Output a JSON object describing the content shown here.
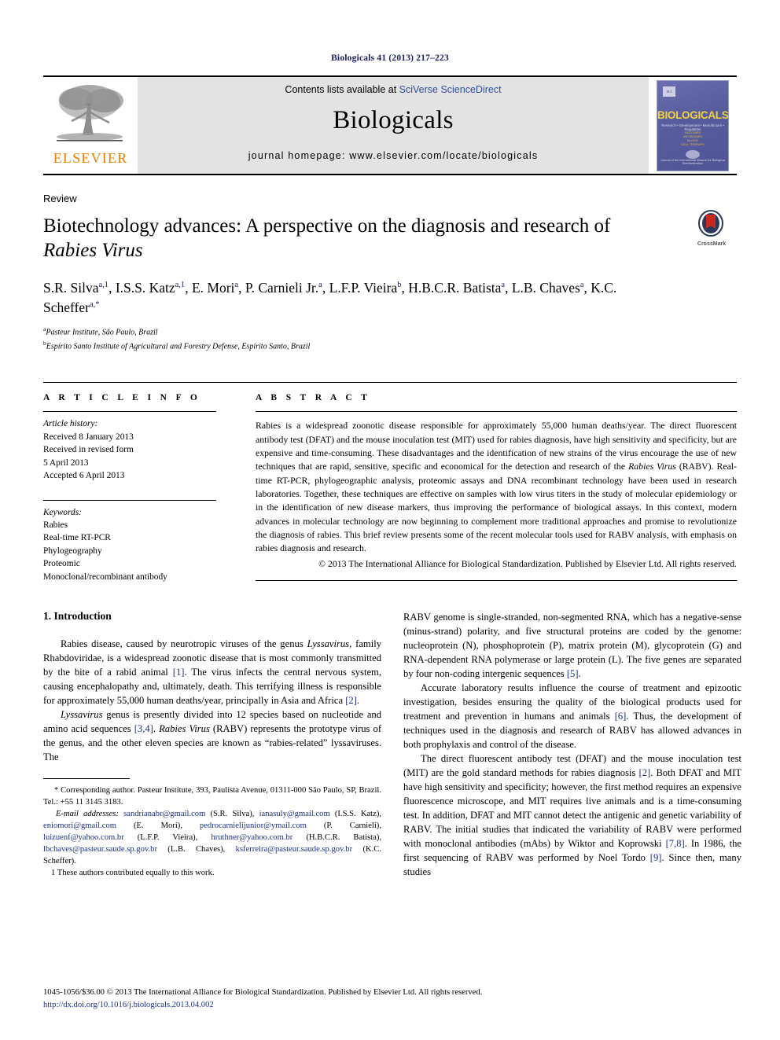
{
  "running_head": "Biologicals 41 (2013) 217–223",
  "masthead": {
    "publisher_name": "ELSEVIER",
    "publisher_logo_icon": "elsevier-tree-icon",
    "contents_prefix": "Contents lists available at ",
    "contents_link": "SciVerse ScienceDirect",
    "journal_name": "Biologicals",
    "homepage": "journal homepage: www.elsevier.com/locate/biologicals",
    "cover": {
      "els_mark": "ELS",
      "title": "BIOLOGICALS",
      "subtitle": "Research • Development • Manufacture • Regulation",
      "lines": "VACCINES\nANTIBODIES\nBLOOD\nCELL THERAPY",
      "footer": "Journal of the International Alliance for Biological Standardization"
    }
  },
  "article": {
    "doctype": "Review",
    "title_part1": "Biotechnology advances: A perspective on the diagnosis and research of ",
    "title_italic": "Rabies Virus",
    "crossmark_label": "CrossMark",
    "authors": "S.R. Silva a,1, I.S.S. Katz a,1, E. Mori a, P. Carnieli Jr. a, L.F.P. Vieira b, H.B.C.R. Batista a, L.B. Chaves a, K.C. Scheffer a,*",
    "affiliation_a": "Pasteur Institute, São Paulo, Brazil",
    "affiliation_b": "Espírito Santo Institute of Agricultural and Forestry Defense, Espírito Santo, Brazil"
  },
  "info": {
    "heading": "A R T I C L E  I N F O",
    "history_label": "Article history:",
    "history": [
      "Received 8 January 2013",
      "Received in revised form",
      "5 April 2013",
      "Accepted 6 April 2013"
    ],
    "keywords_label": "Keywords:",
    "keywords": [
      "Rabies",
      "Real-time RT-PCR",
      "Phylogeography",
      "Proteomic",
      "Monoclonal/recombinant antibody"
    ]
  },
  "abstract": {
    "heading": "A B S T R A C T",
    "text_1": "Rabies is a widespread zoonotic disease responsible for approximately 55,000 human deaths/year. The direct fluorescent antibody test (DFAT) and the mouse inoculation test (MIT) used for rabies diagnosis, have high sensitivity and specificity, but are expensive and time-consuming. These disadvantages and the identification of new strains of the virus encourage the use of new techniques that are rapid, sensitive, specific and economical for the detection and research of the ",
    "italic_1": "Rabies Virus",
    "text_2": " (RABV). Real-time RT-PCR, phylogeographic analysis, proteomic assays and DNA recombinant technology have been used in research laboratories. Together, these techniques are effective on samples with low virus titers in the study of molecular epidemiology or in the identification of new disease markers, thus improving the performance of biological assays. In this context, modern advances in molecular technology are now beginning to complement more traditional approaches and promise to revolutionize the diagnosis of rabies. This brief review presents some of the recent molecular tools used for RABV analysis, with emphasis on rabies diagnosis and research.",
    "copyright": "© 2013 The International Alliance for Biological Standardization. Published by Elsevier Ltd. All rights reserved."
  },
  "body": {
    "section_number_title": "1.  Introduction",
    "left_paragraphs": [
      {
        "segments": [
          {
            "t": "Rabies disease, caused by neurotropic viruses of the genus "
          },
          {
            "t": "Lyssavirus",
            "s": "ital"
          },
          {
            "t": ", family Rhabdoviridae, is a widespread zoonotic disease that is most commonly transmitted by the bite of a rabid animal "
          },
          {
            "t": "[1]",
            "s": "ref"
          },
          {
            "t": ". The virus infects the central nervous system, causing encephalopathy and, ultimately, death. This terrifying illness is responsible for approximately 55,000 human deaths/year, principally in Asia and Africa "
          },
          {
            "t": "[2]",
            "s": "ref"
          },
          {
            "t": "."
          }
        ]
      },
      {
        "segments": [
          {
            "t": "Lyssavirus",
            "s": "ital"
          },
          {
            "t": " genus is presently divided into 12 species based on nucleotide and amino acid sequences "
          },
          {
            "t": "[3,4]",
            "s": "ref"
          },
          {
            "t": ". "
          },
          {
            "t": "Rabies Virus",
            "s": "ital"
          },
          {
            "t": " (RABV) represents the prototype virus of the genus, and the other eleven species are known as “rabies-related” lyssaviruses. The"
          }
        ]
      }
    ],
    "right_paragraphs": [
      {
        "no_indent": true,
        "segments": [
          {
            "t": "RABV genome is single-stranded, non-segmented RNA, which has a negative-sense (minus-strand) polarity, and five structural proteins are coded by the genome: nucleoprotein (N), phosphoprotein (P), matrix protein (M), glycoprotein (G) and RNA-dependent RNA polymerase or large protein (L). The five genes are separated by four non-coding intergenic sequences "
          },
          {
            "t": "[5]",
            "s": "ref"
          },
          {
            "t": "."
          }
        ]
      },
      {
        "segments": [
          {
            "t": "Accurate laboratory results influence the course of treatment and epizootic investigation, besides ensuring the quality of the biological products used for treatment and prevention in humans and animals "
          },
          {
            "t": "[6]",
            "s": "ref"
          },
          {
            "t": ". Thus, the development of techniques used in the diagnosis and research of RABV has allowed advances in both prophylaxis and control of the disease."
          }
        ]
      },
      {
        "segments": [
          {
            "t": "The direct fluorescent antibody test (DFAT) and the mouse inoculation test (MIT) are the gold standard methods for rabies diagnosis "
          },
          {
            "t": "[2]",
            "s": "ref"
          },
          {
            "t": ". Both DFAT and MIT have high sensitivity and specificity; however, the first method requires an expensive fluorescence microscope, and MIT requires live animals and is a time-consuming test. In addition, DFAT and MIT cannot detect the antigenic and genetic variability of RABV. The initial studies that indicated the variability of RABV were performed with monoclonal antibodies (mAbs) by Wiktor and Koprowski "
          },
          {
            "t": "[7,8]",
            "s": "ref"
          },
          {
            "t": ". In 1986, the first sequencing of RABV was performed by Noel Tordo "
          },
          {
            "t": "[9]",
            "s": "ref"
          },
          {
            "t": ". Since then, many studies"
          }
        ]
      }
    ]
  },
  "footnotes": {
    "corresponding": "* Corresponding author. Pasteur Institute, 393, Paulista Avenue, 01311-000 São Paulo, SP, Brazil. Tel.: +55 11 3145 3183.",
    "email_label": "E-mail addresses:",
    "emails": [
      {
        "mail": "sandrianabr@gmail.com",
        "who": "(S.R. Silva)"
      },
      {
        "mail": "ianasuly@gmail.com",
        "who": "(I.S.S. Katz)"
      },
      {
        "mail": "eniomori@gmail.com",
        "who": "(E. Mori)"
      },
      {
        "mail": "pedrocarnielijunior@ymail.com",
        "who": "(P. Carnieli)"
      },
      {
        "mail": "luizuenf@yahoo.com.br",
        "who": "(L.F.P. Vieira)"
      },
      {
        "mail": "hruthner@yahoo.com.br",
        "who": "(H.B.C.R. Batista)"
      },
      {
        "mail": "lbchaves@pasteur.saude.sp.gov.br",
        "who": "(L.B. Chaves)"
      },
      {
        "mail": "ksferreira@pasteur.saude.sp.gov.br",
        "who": "(K.C. Scheffer)"
      }
    ],
    "equal_contribution": "1  These authors contributed equally to this work."
  },
  "page_footer": {
    "copyright_line": "1045-1056/$36.00 © 2013 The International Alliance for Biological Standardization. Published by Elsevier Ltd. All rights reserved.",
    "doi": "http://dx.doi.org/10.1016/j.biologicals.2013.04.002"
  },
  "colors": {
    "link_blue": "#2f4ea1",
    "ref_blue": "#1a2f86",
    "running_head_blue": "#1a2060",
    "elsevier_orange": "#ef7d00",
    "masthead_gray": "#e3e3e3",
    "cover_purple": "#585d9e",
    "cover_yellow": "#f2d23a",
    "crossmark_red": "#c8281e"
  }
}
